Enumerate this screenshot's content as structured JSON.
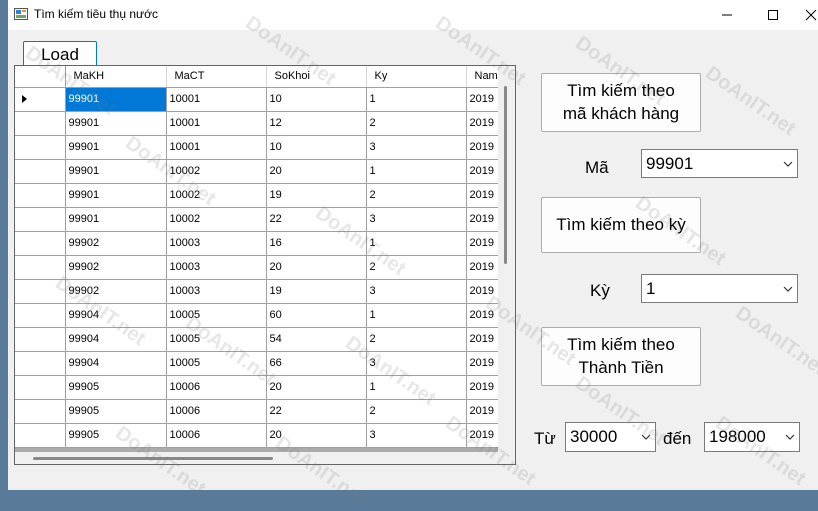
{
  "window": {
    "title": "Tìm kiếm tiêu thụ nước",
    "buttons": {
      "minimize": "minimize",
      "maximize": "maximize",
      "close": "close"
    }
  },
  "toolbar": {
    "load_label": "Load"
  },
  "grid": {
    "columns": [
      "MaKH",
      "MaCT",
      "SoKhoi",
      "Ky",
      "Nam"
    ],
    "rows": [
      [
        "99901",
        "10001",
        "10",
        "1",
        "2019"
      ],
      [
        "99901",
        "10001",
        "12",
        "2",
        "2019"
      ],
      [
        "99901",
        "10001",
        "10",
        "3",
        "2019"
      ],
      [
        "99901",
        "10002",
        "20",
        "1",
        "2019"
      ],
      [
        "99901",
        "10002",
        "19",
        "2",
        "2019"
      ],
      [
        "99901",
        "10002",
        "22",
        "3",
        "2019"
      ],
      [
        "99902",
        "10003",
        "16",
        "1",
        "2019"
      ],
      [
        "99902",
        "10003",
        "20",
        "2",
        "2019"
      ],
      [
        "99902",
        "10003",
        "19",
        "3",
        "2019"
      ],
      [
        "99904",
        "10005",
        "60",
        "1",
        "2019"
      ],
      [
        "99904",
        "10005",
        "54",
        "2",
        "2019"
      ],
      [
        "99904",
        "10005",
        "66",
        "3",
        "2019"
      ],
      [
        "99905",
        "10006",
        "20",
        "1",
        "2019"
      ],
      [
        "99905",
        "10006",
        "22",
        "2",
        "2019"
      ],
      [
        "99905",
        "10006",
        "20",
        "3",
        "2019"
      ]
    ]
  },
  "search": {
    "by_customer_line1": "Tìm kiếm theo",
    "by_customer_line2": "mã khách hàng",
    "code_label": "Mã",
    "code_value": "99901",
    "by_period_label": "Tìm kiếm theo kỳ",
    "period_label": "Kỳ",
    "period_value": "1",
    "by_amount_line1": "Tìm kiếm theo",
    "by_amount_line2": "Thành Tiền",
    "from_label": "Từ",
    "from_value": "30000",
    "to_label": "đến",
    "to_value": "198000"
  },
  "watermark_text": "DoAnIT.net",
  "colors": {
    "selection": "#0078d7",
    "accent_border": "#0078d7"
  }
}
